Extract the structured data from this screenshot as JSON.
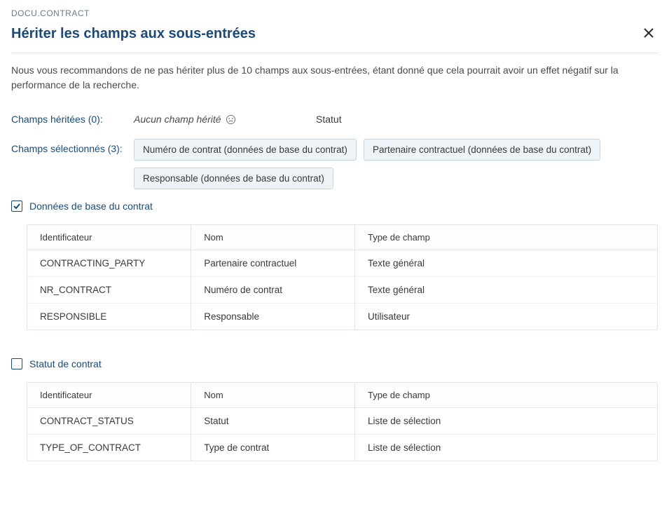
{
  "breadcrumb": "DOCU.CONTRACT",
  "title": "Hériter les champs aux sous-entrées",
  "info": "Nous vous recommandons de ne pas hériter plus de 10 champs aux sous-entrées, étant donné que cela pourrait avoir un effet négatif sur la performance de la recherche.",
  "inherited": {
    "label": "Champs héritées (0):",
    "value": "Aucun champ hérité",
    "status": "Statut"
  },
  "selected": {
    "label": "Champs sélectionnés (3):",
    "chips": [
      "Numéro de contrat (données de base du contrat)",
      "Partenaire contractuel (données de base du contrat)",
      "Responsable (données de base du contrat)"
    ]
  },
  "columns": {
    "id": "Identificateur",
    "name": "Nom",
    "type": "Type de champ"
  },
  "sections": [
    {
      "title": "Données de base du contrat",
      "checked": true,
      "rows": [
        {
          "id": "CONTRACTING_PARTY",
          "name": "Partenaire contractuel",
          "type": "Texte général"
        },
        {
          "id": "NR_CONTRACT",
          "name": "Numéro de contrat",
          "type": "Texte général"
        },
        {
          "id": "RESPONSIBLE",
          "name": "Responsable",
          "type": "Utilisateur"
        }
      ]
    },
    {
      "title": "Statut de contrat",
      "checked": false,
      "rows": [
        {
          "id": "CONTRACT_STATUS",
          "name": "Statut",
          "type": "Liste de sélection"
        },
        {
          "id": "TYPE_OF_CONTRACT",
          "name": "Type de contrat",
          "type": "Liste de sélection"
        }
      ]
    }
  ]
}
